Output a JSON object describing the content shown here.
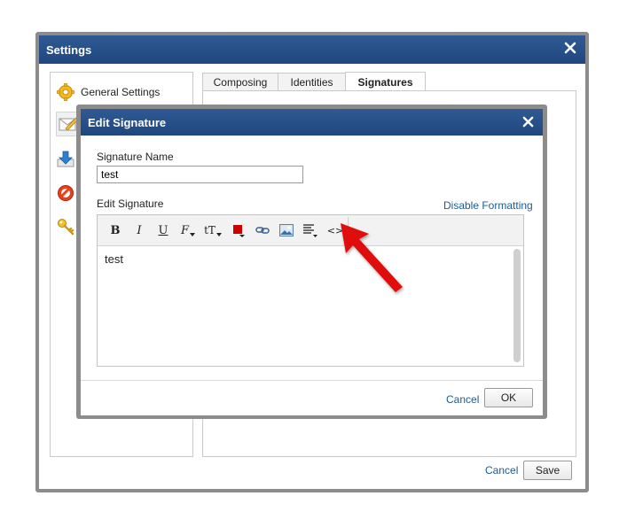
{
  "settings_window": {
    "title": "Settings",
    "sidebar": {
      "items": [
        {
          "label": "General Settings",
          "icon": "gear-icon"
        },
        {
          "label": "",
          "icon": "compose-icon"
        },
        {
          "label": "",
          "icon": "download-icon"
        },
        {
          "label": "",
          "icon": "block-icon"
        },
        {
          "label": "",
          "icon": "key-icon"
        }
      ]
    },
    "tabs": [
      {
        "label": "Composing"
      },
      {
        "label": "Identities"
      },
      {
        "label": "Signatures",
        "active": true
      }
    ],
    "cancel_label": "Cancel",
    "save_label": "Save"
  },
  "edit_signature_dialog": {
    "title": "Edit Signature",
    "signature_name_label": "Signature Name",
    "signature_name_value": "test",
    "edit_signature_label": "Edit Signature",
    "disable_formatting_label": "Disable Formatting",
    "toolbar": {
      "bold": "B",
      "italic": "I",
      "underline": "U",
      "font_family": "F",
      "font_size": "tT",
      "source": "<>"
    },
    "editor_content": "test",
    "cancel_label": "Cancel",
    "ok_label": "OK"
  },
  "colors": {
    "titlebar": "#2a5590",
    "link": "#1a5b99",
    "text_color_swatch": "#cc0000",
    "annotation_arrow": "#e01010"
  }
}
